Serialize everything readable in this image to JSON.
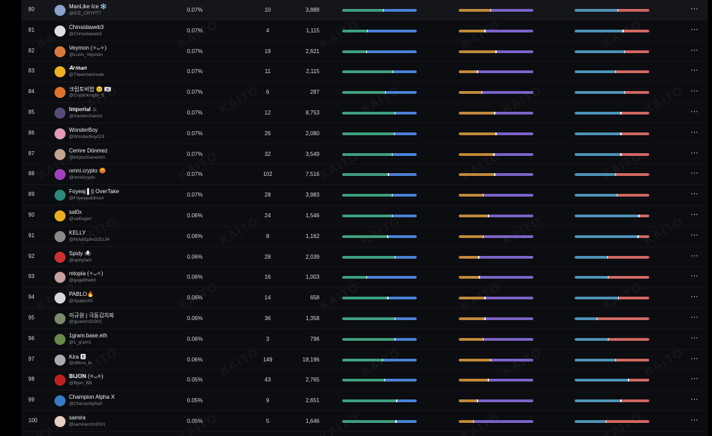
{
  "watermark_text": "KAITO",
  "more_icon": "⋯",
  "colors": {
    "bar1": [
      "#3ea07f",
      "#4a82d8"
    ],
    "bar2": [
      "#c28a3a",
      "#7c63c8"
    ],
    "bar3": [
      "#4e93b9",
      "#d06862"
    ]
  },
  "rows": [
    {
      "rank": "80",
      "name": "ManLike Ice ❄️",
      "handle": "@ICE_CRYPTT",
      "share": "0.07%",
      "count": "10",
      "views": "3,889",
      "split": [
        55,
        43,
        58
      ],
      "avatar": "#8aa3c9"
    },
    {
      "rank": "81",
      "name": "Chinsidaweb3",
      "handle": "@Chinsidaweb3",
      "share": "0.07%",
      "count": "4",
      "views": "1,115",
      "split": [
        34,
        35,
        65
      ],
      "avatar": "#e0e0e0"
    },
    {
      "rank": "82",
      "name": "Veymon (✧ᴗ✧)",
      "handle": "@Lucis_Veymon",
      "share": "0.07%",
      "count": "19",
      "views": "2,621",
      "split": [
        33,
        50,
        67
      ],
      "avatar": "#d87a3c"
    },
    {
      "rank": "83",
      "name": "𝑨𝒓𝒎𝒂𝒏",
      "handle": "@Thearmannode",
      "share": "0.07%",
      "count": "11",
      "views": "2,115",
      "split": [
        68,
        25,
        55
      ],
      "avatar": "#f0b020"
    },
    {
      "rank": "84",
      "name": "크립토비밥 😊 🇰🇷",
      "handle": "@Cryptoknight_S",
      "share": "0.07%",
      "count": "6",
      "views": "287",
      "split": [
        58,
        31,
        67
      ],
      "avatar": "#e0732a"
    },
    {
      "rank": "85",
      "name": "𝐈𝐦𝐩𝐞𝐫𝐢𝐚𝐥 ♨",
      "handle": "@masterchainzz",
      "share": "0.07%",
      "count": "12",
      "views": "8,753",
      "split": [
        71,
        48,
        62
      ],
      "avatar": "#5a4a7a"
    },
    {
      "rank": "86",
      "name": "WonderBoy",
      "handle": "@WonderBoy023",
      "share": "0.07%",
      "count": "26",
      "views": "2,080",
      "split": [
        70,
        50,
        62
      ],
      "avatar": "#e39bb4"
    },
    {
      "rank": "87",
      "name": "Cemre Dönmez",
      "handle": "@kriptozfsanemm",
      "share": "0.07%",
      "count": "32",
      "views": "3,549",
      "split": [
        67,
        47,
        62
      ],
      "avatar": "#c4a48a"
    },
    {
      "rank": "88",
      "name": "omni.crypto 😡",
      "handle": "@omnicryptx",
      "share": "0.07%",
      "count": "102",
      "views": "7,516",
      "split": [
        62,
        48,
        55
      ],
      "avatar": "#a040c0"
    },
    {
      "rank": "89",
      "name": "Foyeaj ▌|| OverTake",
      "handle": "@Foyeajuddinovi",
      "share": "0.07%",
      "count": "28",
      "views": "3,983",
      "split": [
        67,
        33,
        57
      ],
      "avatar": "#2a8a7a"
    },
    {
      "rank": "90",
      "name": "sal0x",
      "handle": "@sal0xgen",
      "share": "0.06%",
      "count": "24",
      "views": "1,546",
      "split": [
        67,
        40,
        86
      ],
      "avatar": "#e8b020"
    },
    {
      "rank": "91",
      "name": "KELLY",
      "handle": "@NovaSpire325134",
      "share": "0.06%",
      "count": "8",
      "views": "1,162",
      "split": [
        61,
        33,
        85
      ],
      "avatar": "#8a8a8a"
    },
    {
      "rank": "92",
      "name": "Spidy 🕷",
      "handle": "@spidyfam",
      "share": "0.06%",
      "count": "28",
      "views": "2,039",
      "split": [
        71,
        27,
        44
      ],
      "avatar": "#d03030"
    },
    {
      "rank": "93",
      "name": "mtopia (✧ᴗ✧)",
      "handle": "@gogetthebit",
      "share": "0.06%",
      "count": "16",
      "views": "1,003",
      "split": [
        33,
        28,
        45
      ],
      "avatar": "#c8a0a0"
    },
    {
      "rank": "94",
      "name": "PABLO🔥",
      "handle": "@XpabloX0",
      "share": "0.06%",
      "count": "14",
      "views": "658",
      "split": [
        61,
        35,
        59
      ],
      "avatar": "#d8d8d8"
    },
    {
      "rank": "95",
      "name": "이규원 | 극동김치파",
      "handle": "@gyuwon30303",
      "share": "0.06%",
      "count": "36",
      "views": "1,358",
      "split": [
        71,
        35,
        30
      ],
      "avatar": "#7a8a6a"
    },
    {
      "rank": "96",
      "name": "1gram.base.eth",
      "handle": "@1_gram1",
      "share": "0.06%",
      "count": "3",
      "views": "796",
      "split": [
        71,
        33,
        45
      ],
      "avatar": "#6a8a4a"
    },
    {
      "rank": "97",
      "name": "Kira 🅱",
      "handle": "@nftkira_kr",
      "share": "0.06%",
      "count": "149",
      "views": "18,196",
      "split": [
        54,
        43,
        55
      ],
      "avatar": "#aaaab0"
    },
    {
      "rank": "98",
      "name": "𝐁𝐈𝐉𝐎𝐍 (✧ᴗ✧)",
      "handle": "@Bijon_BB",
      "share": "0.05%",
      "count": "43",
      "views": "2,765",
      "split": [
        57,
        40,
        72
      ],
      "avatar": "#c02020"
    },
    {
      "rank": "99",
      "name": "Champion Alpha X",
      "handle": "@ChampAlphaX",
      "share": "0.05%",
      "count": "9",
      "views": "2,651",
      "split": [
        73,
        25,
        62
      ],
      "avatar": "#3a7ac8"
    },
    {
      "rank": "100",
      "name": "samira",
      "handle": "@samiranzm2001",
      "share": "0.05%",
      "count": "5",
      "views": "1,646",
      "split": [
        72,
        20,
        42
      ],
      "avatar": "#e8d0c0"
    }
  ]
}
